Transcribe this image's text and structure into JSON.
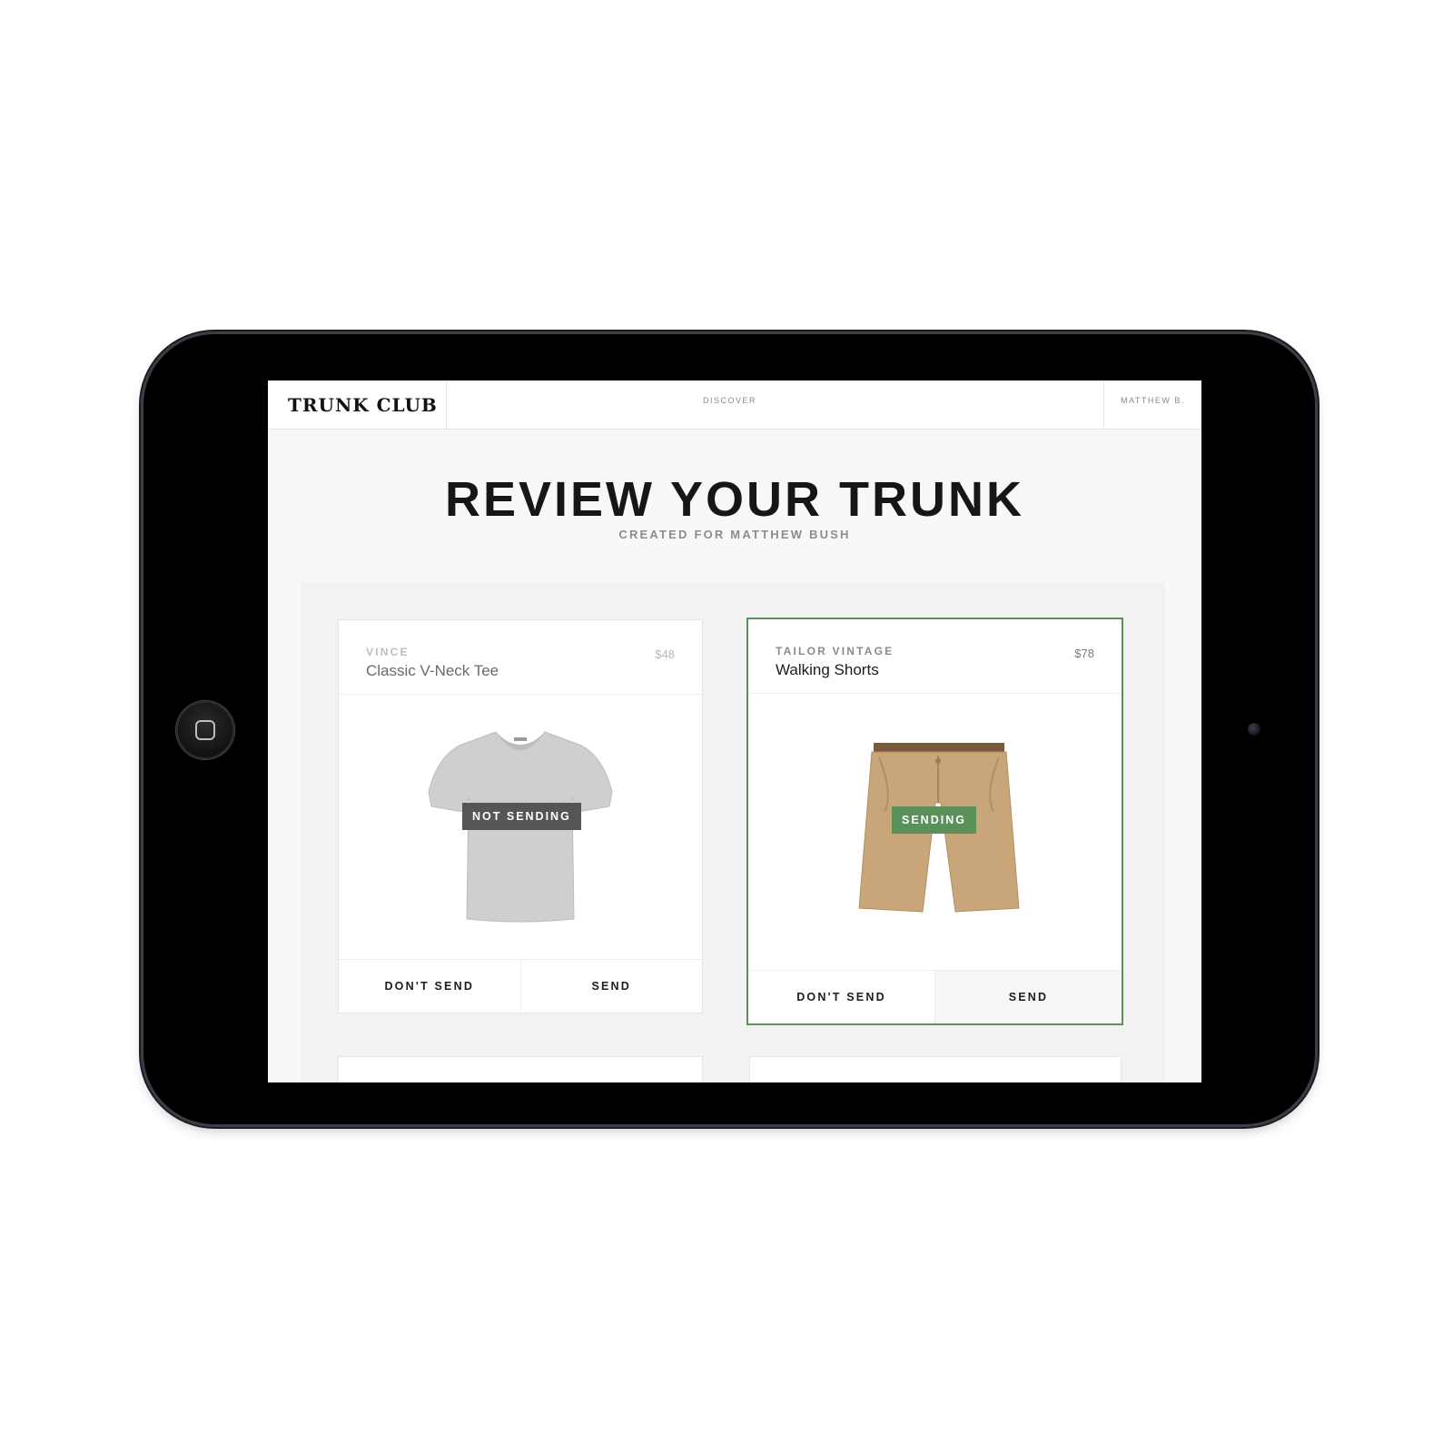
{
  "app": {
    "brand": "TRUNK CLUB",
    "nav": {
      "discover": "DISCOVER",
      "user": "MATTHEW B."
    }
  },
  "page": {
    "title": "REVIEW YOUR TRUNK",
    "subtitle": "CREATED FOR MATTHEW BUSH"
  },
  "items": [
    {
      "brand": "VINCE",
      "name": "Classic V-Neck Tee",
      "price": "$48",
      "status": "NOT SENDING",
      "dont_send_label": "DON'T SEND",
      "send_label": "SEND",
      "selected": false
    },
    {
      "brand": "TAILOR VINTAGE",
      "name": "Walking Shorts",
      "price": "$78",
      "status": "SENDING",
      "dont_send_label": "DON'T SEND",
      "send_label": "SEND",
      "selected": true
    }
  ],
  "colors": {
    "accent_green": "#5a9158",
    "badge_gray": "#555555",
    "device_black": "#000000"
  },
  "icons": {
    "home_button": "home-square-icon",
    "camera": "camera-dot-icon"
  }
}
